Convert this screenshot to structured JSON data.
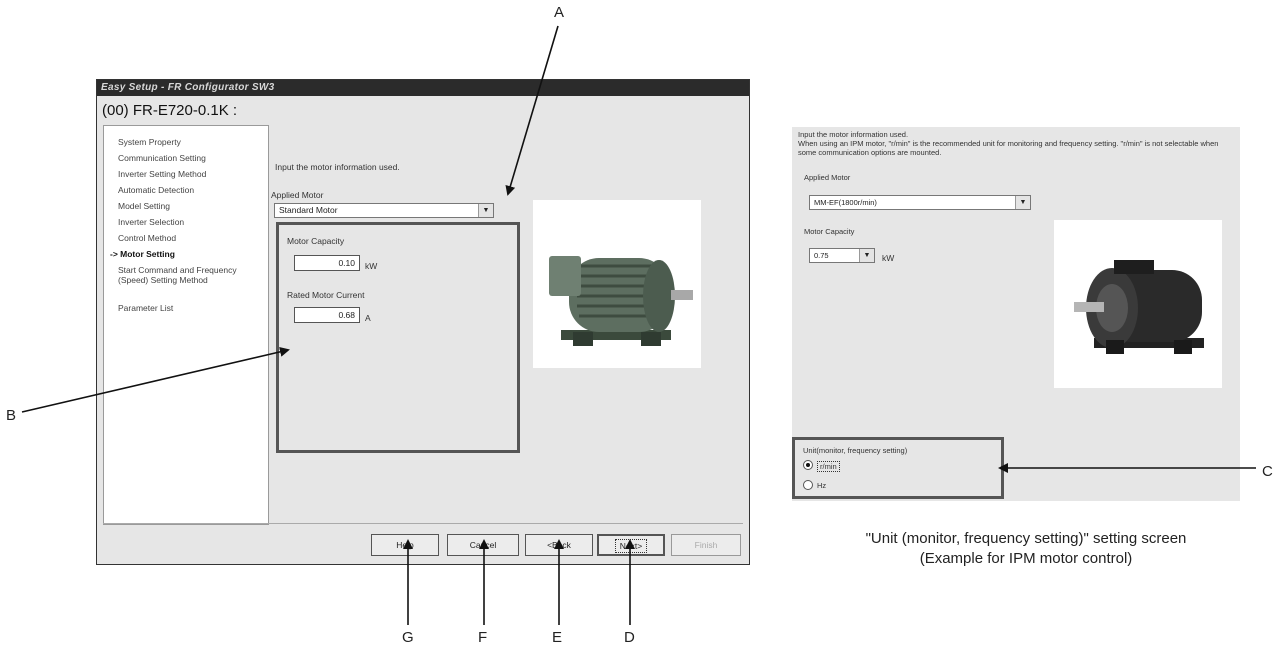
{
  "window": {
    "title": "Easy Setup - FR Configurator SW3",
    "heading": "(00) FR-E720-0.1K :"
  },
  "nav": {
    "items": [
      "System Property",
      "Communication Setting",
      "Inverter Setting Method",
      "Automatic Detection",
      "Model Setting",
      "Inverter Selection",
      "Control Method",
      "-> Motor Setting",
      "Start Command and Frequency (Speed) Setting Method",
      "Parameter List"
    ]
  },
  "content": {
    "instruction": "Input the motor information used.",
    "applied_motor_label": "Applied Motor",
    "applied_motor_value": "Standard Motor",
    "motor_capacity_label": "Motor Capacity",
    "motor_capacity_value": "0.10",
    "motor_capacity_unit": "kW",
    "rated_current_label": "Rated Motor Current",
    "rated_current_value": "0.68",
    "rated_current_unit": "A"
  },
  "buttons": {
    "help": "Help",
    "cancel": "Cancel",
    "back": "<Back",
    "next": "Next>",
    "finish": "Finish"
  },
  "ipm_panel": {
    "instruction_1": "Input the motor information used.",
    "instruction_2": "When using an IPM motor, \"r/min\" is the recommended unit for monitoring and frequency setting. \"r/min\" is not selectable when some communication options are mounted.",
    "applied_motor_label": "Applied Motor",
    "applied_motor_value": "MM-EF(1800r/min)",
    "motor_capacity_label": "Motor Capacity",
    "motor_capacity_value": "0.75",
    "motor_capacity_unit": "kW",
    "unit_group_label": "Unit(monitor, frequency setting)",
    "unit_options": [
      "r/min",
      "Hz"
    ],
    "unit_selected": "r/min"
  },
  "caption": {
    "line1": "\"Unit (monitor, frequency setting)\" setting screen",
    "line2": "(Example for IPM motor control)"
  },
  "callouts": [
    "A",
    "B",
    "C",
    "D",
    "E",
    "F",
    "G"
  ]
}
